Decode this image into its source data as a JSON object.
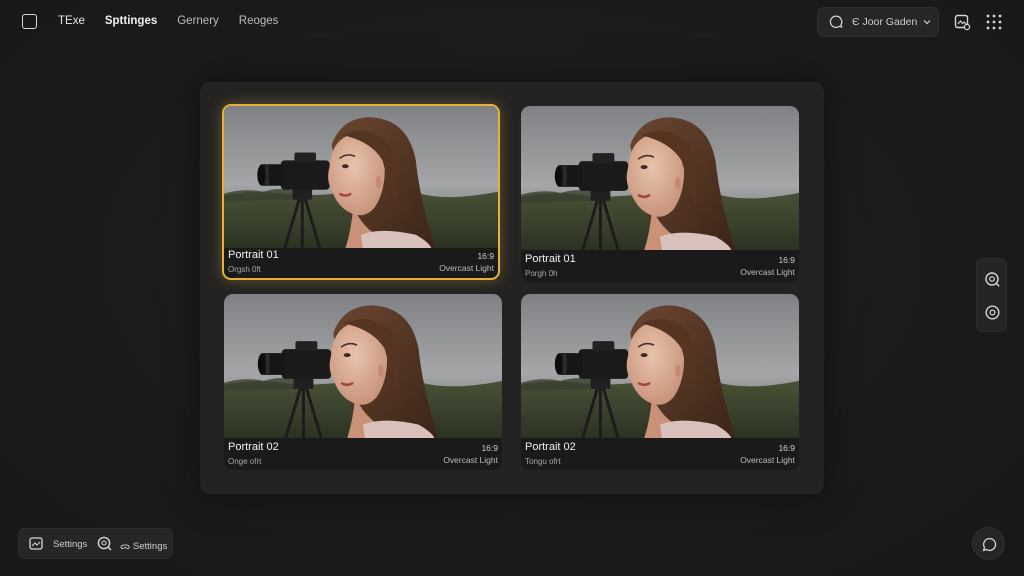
{
  "topbar": {
    "brand": "TExe",
    "nav": [
      {
        "label": "Spttinges",
        "active": true
      },
      {
        "label": "Gernery",
        "active": false
      },
      {
        "label": "Reoges",
        "active": false
      }
    ],
    "account_label": "Є Joor Gaden"
  },
  "cards": [
    {
      "title": "Portrait 01",
      "subtitle": "Orgsh 0ft",
      "ratio": "16:9",
      "lighting": "Overcast Light",
      "selected": true
    },
    {
      "title": "Portrait 01",
      "subtitle": "Porgh 0h",
      "ratio": "16:9",
      "lighting": "Overcast Light",
      "selected": false
    },
    {
      "title": "Portrait 02",
      "subtitle": "Оnge ofrt",
      "ratio": "16:9",
      "lighting": "Overcast Light",
      "selected": false
    },
    {
      "title": "Portrait 02",
      "subtitle": "Tongu ofrt",
      "ratio": "16:9",
      "lighting": "Overcast Light",
      "selected": false
    }
  ],
  "bottombar": {
    "item1_label": "Settings",
    "item2_label": "ᯅ Settings"
  },
  "colors": {
    "accent_selected": "#e2b23a",
    "background": "#1b1b1b",
    "panel": "#232323"
  }
}
